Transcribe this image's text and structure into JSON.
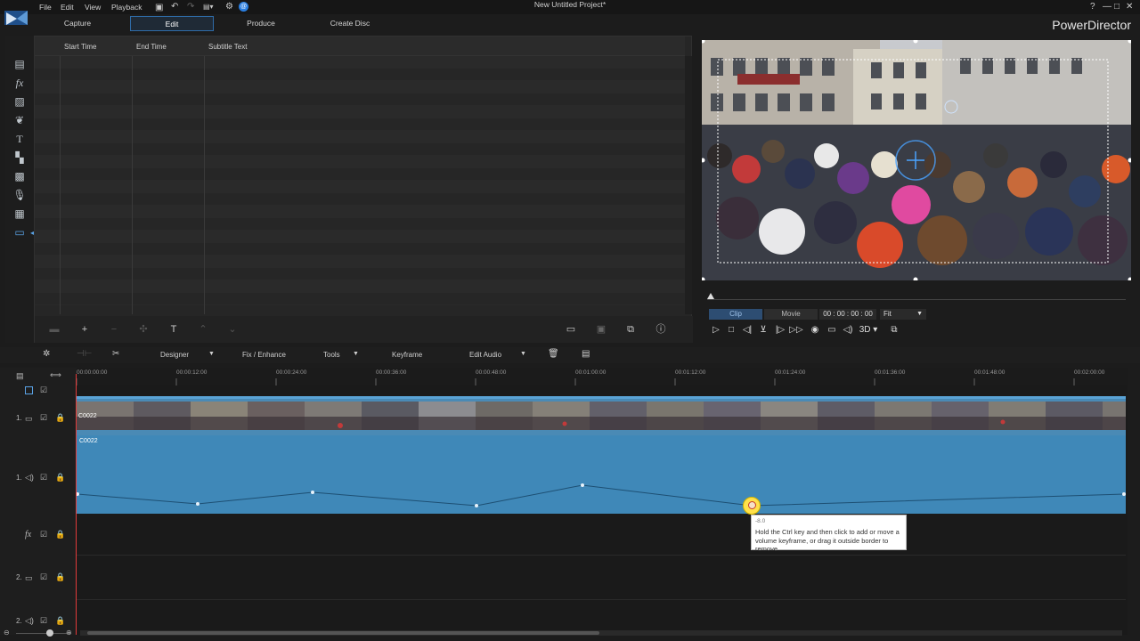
{
  "menu": {
    "items": [
      "File",
      "Edit",
      "View",
      "Playback"
    ],
    "window_title": "New Untitled Project*",
    "brand": "PowerDirector"
  },
  "tabs": [
    "Capture",
    "Edit",
    "Produce",
    "Create Disc"
  ],
  "active_tab": "Edit",
  "subtitle_panel": {
    "headers": [
      "Start Time",
      "End Time",
      "Subtitle Text"
    ]
  },
  "preview": {
    "clip_label": "Clip",
    "movie_label": "Movie",
    "timecode": "00 : 00 : 00 : 00",
    "zoom": "Fit",
    "mode_3d": "3D"
  },
  "toolbar": {
    "designer": "Designer",
    "fix_enhance": "Fix / Enhance",
    "tools": "Tools",
    "keyframe": "Keyframe",
    "edit_audio": "Edit Audio"
  },
  "ruler": {
    "ticks": [
      "00:00:00:00",
      "00:00:12:00",
      "00:00:24:00",
      "00:00:36:00",
      "00:00:48:00",
      "00:01:00:00",
      "00:01:12:00",
      "00:01:24:00",
      "00:01:36:00",
      "00:01:48:00",
      "00:02:00:00"
    ]
  },
  "tracks": {
    "video1_label": "1.",
    "audio1_label": "1.",
    "video2_label": "2.",
    "audio2_label": "2.",
    "fx_label": "fx",
    "video_clip_name": "C0022",
    "audio_clip_name": "C0022"
  },
  "tooltip": {
    "value": "-8.0",
    "text": "Hold the Ctrl key and then click to add or move a volume keyframe, or drag it outside border to remove"
  },
  "colors": {
    "accent": "#2f6ca8",
    "track_blue": "#3f88b8",
    "playhead": "#e23b3b",
    "keyframe": "#ffe14a"
  }
}
